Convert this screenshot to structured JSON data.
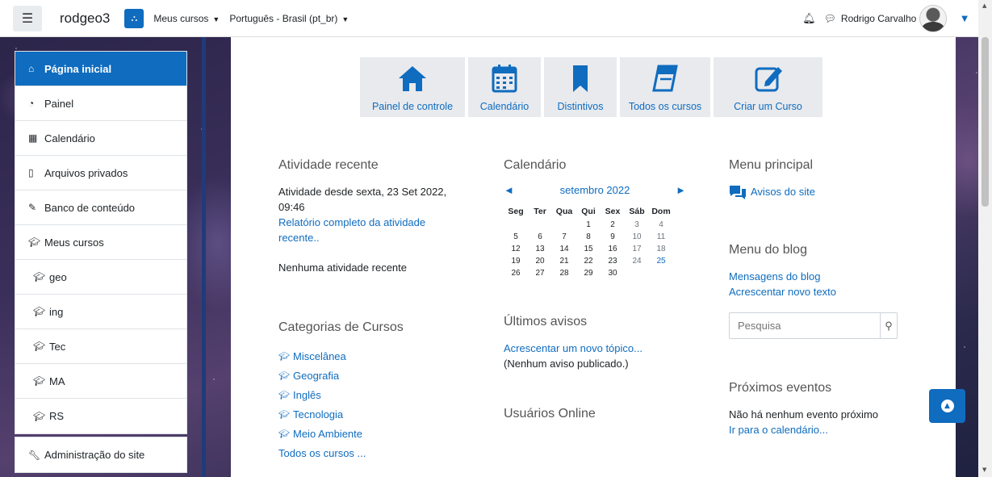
{
  "navbar": {
    "site_name": "rodgeo3",
    "menu_courses": "Meus cursos",
    "menu_language": "Português - Brasil (pt_br)",
    "user_name": "Rodrigo Carvalho"
  },
  "drawer": {
    "items": [
      {
        "label": "Página inicial",
        "icon": "home-icon"
      },
      {
        "label": "Painel",
        "icon": "dashboard-icon"
      },
      {
        "label": "Calendário",
        "icon": "calendar-icon"
      },
      {
        "label": "Arquivos privados",
        "icon": "file-icon"
      },
      {
        "label": "Banco de conteúdo",
        "icon": "brush-icon"
      },
      {
        "label": "Meus cursos",
        "icon": "graduation-cap-icon"
      },
      {
        "label": "geo",
        "icon": "graduation-cap-icon"
      },
      {
        "label": "ing",
        "icon": "graduation-cap-icon"
      },
      {
        "label": "Tec",
        "icon": "graduation-cap-icon"
      },
      {
        "label": "MA",
        "icon": "graduation-cap-icon"
      },
      {
        "label": "RS",
        "icon": "graduation-cap-icon"
      }
    ],
    "admin": "Administração do site"
  },
  "tiles": [
    {
      "label": "Painel de controle",
      "icon": "home-icon"
    },
    {
      "label": "Calendário",
      "icon": "calendar-icon"
    },
    {
      "label": "Distintivos",
      "icon": "bookmark-icon"
    },
    {
      "label": "Todos os cursos",
      "icon": "book-icon"
    },
    {
      "label": "Criar um Curso",
      "icon": "edit-icon"
    }
  ],
  "recent": {
    "title": "Atividade recente",
    "since_line1": "Atividade desde sexta, 23 Set 2022,",
    "since_line2": "09:46",
    "report_link_line1": "Relatório completo da atividade",
    "report_link_line2": "recente..",
    "none": "Nenhuma atividade recente"
  },
  "categories": {
    "title": "Categorias de Cursos",
    "items": [
      "Miscelânea",
      "Geografia",
      "Inglês",
      "Tecnologia",
      "Meio Ambiente"
    ],
    "all_link": "Todos os cursos ..."
  },
  "calendar": {
    "title": "Calendário",
    "month": "setembro 2022",
    "prev": "◄",
    "next": "►",
    "weekdays": [
      "Seg",
      "Ter",
      "Qua",
      "Qui",
      "Sex",
      "Sáb",
      "Dom"
    ],
    "weeks": [
      [
        "",
        "",
        "",
        "1",
        "2",
        "3",
        "4"
      ],
      [
        "5",
        "6",
        "7",
        "8",
        "9",
        "10",
        "11"
      ],
      [
        "12",
        "13",
        "14",
        "15",
        "16",
        "17",
        "18"
      ],
      [
        "19",
        "20",
        "21",
        "22",
        "23",
        "24",
        "25"
      ],
      [
        "26",
        "27",
        "28",
        "29",
        "30",
        "",
        ""
      ]
    ]
  },
  "news": {
    "title": "Últimos avisos",
    "add_link": "Acrescentar um novo tópico...",
    "none": "(Nenhum aviso publicado.)"
  },
  "online": {
    "title": "Usuários Online"
  },
  "main_menu": {
    "title": "Menu principal",
    "item": "Avisos do site"
  },
  "blog_menu": {
    "title": "Menu do blog",
    "link1": "Mensagens do blog",
    "link2": "Acrescentar novo texto",
    "search_placeholder": "Pesquisa"
  },
  "events": {
    "title": "Próximos eventos",
    "none": "Não há nenhum evento próximo",
    "link": "Ir para o calendário..."
  },
  "colors": {
    "brand": "#0f6cbf"
  }
}
